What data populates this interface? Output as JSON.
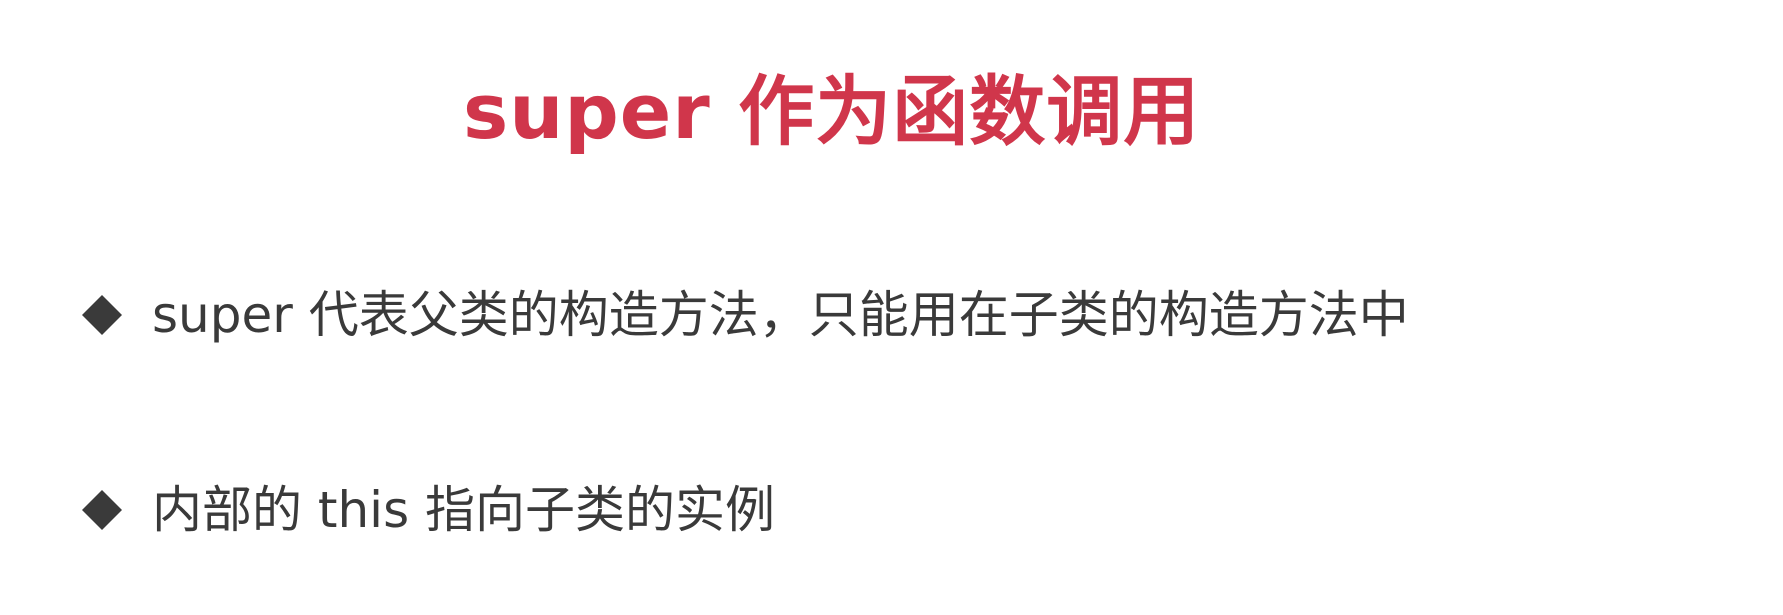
{
  "slide": {
    "title": "super 作为函数调用",
    "bullets": [
      {
        "icon": "diamond-bullet-icon",
        "text": "super 代表父类的构造方法，只能用在子类的构造方法中"
      },
      {
        "icon": "diamond-bullet-icon",
        "text": "内部的 this 指向子类的实例"
      }
    ]
  },
  "colors": {
    "title": "#d0364b",
    "body_text": "#3a3a3a",
    "bullet_icon": "#3a3a3a",
    "background": "#ffffff"
  }
}
